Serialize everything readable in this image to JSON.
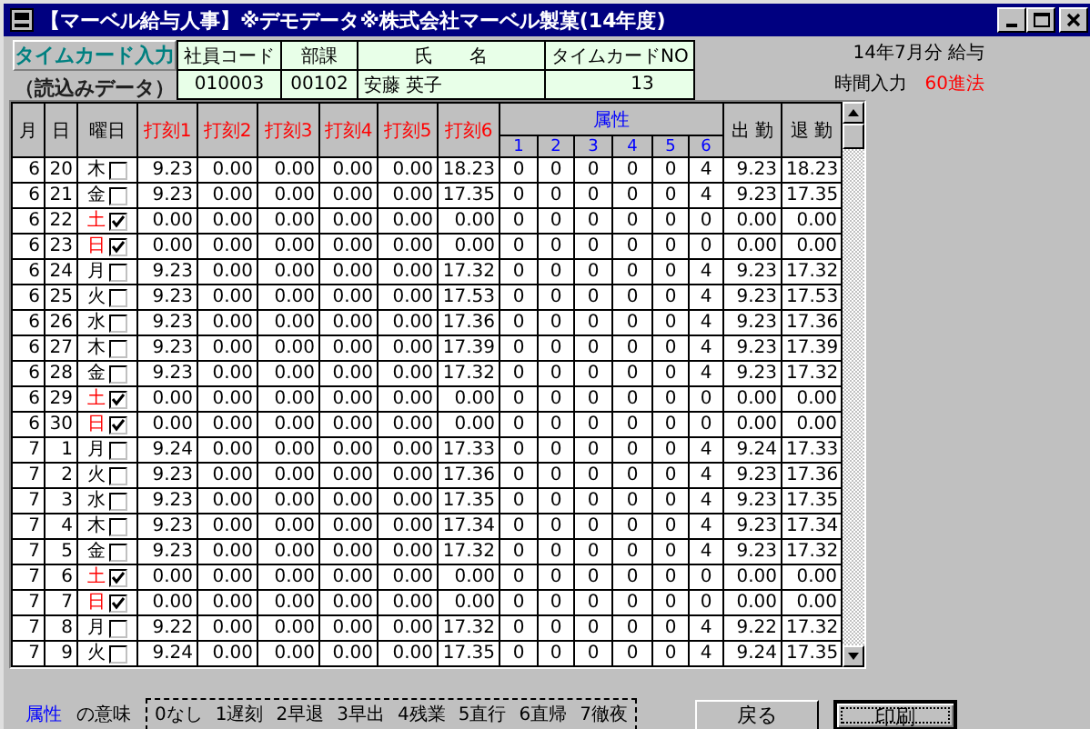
{
  "window": {
    "title": "【マーベル給与人事】※デモデータ※株式会社マーベル製菓(14年度)"
  },
  "header": {
    "mode_label": "タイムカード入力",
    "mode_sub": "（読込みデータ）",
    "employee": [
      {
        "label": "社員コード",
        "value": "010003"
      },
      {
        "label": "部課",
        "value": "00102"
      },
      {
        "label": "氏　　名",
        "value": "安藤 英子"
      },
      {
        "label": "タイムカードNO",
        "value": "13"
      }
    ],
    "period": "14年7月分 給与",
    "input_label": "時間入力",
    "input_mode": "60進法"
  },
  "columns": {
    "month": "月",
    "day": "日",
    "weekday": "曜日",
    "punches": [
      "打刻1",
      "打刻2",
      "打刻3",
      "打刻4",
      "打刻5",
      "打刻6"
    ],
    "attribute_group": "属性",
    "attributes": [
      "1",
      "2",
      "3",
      "4",
      "5",
      "6"
    ],
    "clock_in": "出 勤",
    "clock_out": "退 勤"
  },
  "rows": [
    {
      "month": "6",
      "day": "20",
      "weekday": "木",
      "color": "#000000",
      "checked": false,
      "punches": [
        "9.23",
        "0.00",
        "0.00",
        "0.00",
        "0.00",
        "18.23"
      ],
      "attributes": [
        "0",
        "0",
        "0",
        "0",
        "0",
        "4"
      ],
      "clock_in": "9.23",
      "clock_out": "18.23"
    },
    {
      "month": "6",
      "day": "21",
      "weekday": "金",
      "color": "#000000",
      "checked": false,
      "punches": [
        "9.23",
        "0.00",
        "0.00",
        "0.00",
        "0.00",
        "17.35"
      ],
      "attributes": [
        "0",
        "0",
        "0",
        "0",
        "0",
        "4"
      ],
      "clock_in": "9.23",
      "clock_out": "17.35"
    },
    {
      "month": "6",
      "day": "22",
      "weekday": "土",
      "color": "#ff0000",
      "checked": true,
      "punches": [
        "0.00",
        "0.00",
        "0.00",
        "0.00",
        "0.00",
        "0.00"
      ],
      "attributes": [
        "0",
        "0",
        "0",
        "0",
        "0",
        "0"
      ],
      "clock_in": "0.00",
      "clock_out": "0.00"
    },
    {
      "month": "6",
      "day": "23",
      "weekday": "日",
      "color": "#ff0000",
      "checked": true,
      "punches": [
        "0.00",
        "0.00",
        "0.00",
        "0.00",
        "0.00",
        "0.00"
      ],
      "attributes": [
        "0",
        "0",
        "0",
        "0",
        "0",
        "0"
      ],
      "clock_in": "0.00",
      "clock_out": "0.00"
    },
    {
      "month": "6",
      "day": "24",
      "weekday": "月",
      "color": "#000000",
      "checked": false,
      "punches": [
        "9.23",
        "0.00",
        "0.00",
        "0.00",
        "0.00",
        "17.32"
      ],
      "attributes": [
        "0",
        "0",
        "0",
        "0",
        "0",
        "4"
      ],
      "clock_in": "9.23",
      "clock_out": "17.32"
    },
    {
      "month": "6",
      "day": "25",
      "weekday": "火",
      "color": "#000000",
      "checked": false,
      "punches": [
        "9.23",
        "0.00",
        "0.00",
        "0.00",
        "0.00",
        "17.53"
      ],
      "attributes": [
        "0",
        "0",
        "0",
        "0",
        "0",
        "4"
      ],
      "clock_in": "9.23",
      "clock_out": "17.53"
    },
    {
      "month": "6",
      "day": "26",
      "weekday": "水",
      "color": "#000000",
      "checked": false,
      "punches": [
        "9.23",
        "0.00",
        "0.00",
        "0.00",
        "0.00",
        "17.36"
      ],
      "attributes": [
        "0",
        "0",
        "0",
        "0",
        "0",
        "4"
      ],
      "clock_in": "9.23",
      "clock_out": "17.36"
    },
    {
      "month": "6",
      "day": "27",
      "weekday": "木",
      "color": "#000000",
      "checked": false,
      "punches": [
        "9.23",
        "0.00",
        "0.00",
        "0.00",
        "0.00",
        "17.39"
      ],
      "attributes": [
        "0",
        "0",
        "0",
        "0",
        "0",
        "4"
      ],
      "clock_in": "9.23",
      "clock_out": "17.39"
    },
    {
      "month": "6",
      "day": "28",
      "weekday": "金",
      "color": "#000000",
      "checked": false,
      "punches": [
        "9.23",
        "0.00",
        "0.00",
        "0.00",
        "0.00",
        "17.32"
      ],
      "attributes": [
        "0",
        "0",
        "0",
        "0",
        "0",
        "4"
      ],
      "clock_in": "9.23",
      "clock_out": "17.32"
    },
    {
      "month": "6",
      "day": "29",
      "weekday": "土",
      "color": "#ff0000",
      "checked": true,
      "punches": [
        "0.00",
        "0.00",
        "0.00",
        "0.00",
        "0.00",
        "0.00"
      ],
      "attributes": [
        "0",
        "0",
        "0",
        "0",
        "0",
        "0"
      ],
      "clock_in": "0.00",
      "clock_out": "0.00"
    },
    {
      "month": "6",
      "day": "30",
      "weekday": "日",
      "color": "#ff0000",
      "checked": true,
      "punches": [
        "0.00",
        "0.00",
        "0.00",
        "0.00",
        "0.00",
        "0.00"
      ],
      "attributes": [
        "0",
        "0",
        "0",
        "0",
        "0",
        "0"
      ],
      "clock_in": "0.00",
      "clock_out": "0.00"
    },
    {
      "month": "7",
      "day": "1",
      "weekday": "月",
      "color": "#000000",
      "checked": false,
      "punches": [
        "9.24",
        "0.00",
        "0.00",
        "0.00",
        "0.00",
        "17.33"
      ],
      "attributes": [
        "0",
        "0",
        "0",
        "0",
        "0",
        "4"
      ],
      "clock_in": "9.24",
      "clock_out": "17.33"
    },
    {
      "month": "7",
      "day": "2",
      "weekday": "火",
      "color": "#000000",
      "checked": false,
      "punches": [
        "9.23",
        "0.00",
        "0.00",
        "0.00",
        "0.00",
        "17.36"
      ],
      "attributes": [
        "0",
        "0",
        "0",
        "0",
        "0",
        "4"
      ],
      "clock_in": "9.23",
      "clock_out": "17.36"
    },
    {
      "month": "7",
      "day": "3",
      "weekday": "水",
      "color": "#000000",
      "checked": false,
      "punches": [
        "9.23",
        "0.00",
        "0.00",
        "0.00",
        "0.00",
        "17.35"
      ],
      "attributes": [
        "0",
        "0",
        "0",
        "0",
        "0",
        "4"
      ],
      "clock_in": "9.23",
      "clock_out": "17.35"
    },
    {
      "month": "7",
      "day": "4",
      "weekday": "木",
      "color": "#000000",
      "checked": false,
      "punches": [
        "9.23",
        "0.00",
        "0.00",
        "0.00",
        "0.00",
        "17.34"
      ],
      "attributes": [
        "0",
        "0",
        "0",
        "0",
        "0",
        "4"
      ],
      "clock_in": "9.23",
      "clock_out": "17.34"
    },
    {
      "month": "7",
      "day": "5",
      "weekday": "金",
      "color": "#000000",
      "checked": false,
      "punches": [
        "9.23",
        "0.00",
        "0.00",
        "0.00",
        "0.00",
        "17.32"
      ],
      "attributes": [
        "0",
        "0",
        "0",
        "0",
        "0",
        "4"
      ],
      "clock_in": "9.23",
      "clock_out": "17.32"
    },
    {
      "month": "7",
      "day": "6",
      "weekday": "土",
      "color": "#ff0000",
      "checked": true,
      "punches": [
        "0.00",
        "0.00",
        "0.00",
        "0.00",
        "0.00",
        "0.00"
      ],
      "attributes": [
        "0",
        "0",
        "0",
        "0",
        "0",
        "0"
      ],
      "clock_in": "0.00",
      "clock_out": "0.00"
    },
    {
      "month": "7",
      "day": "7",
      "weekday": "日",
      "color": "#ff0000",
      "checked": true,
      "punches": [
        "0.00",
        "0.00",
        "0.00",
        "0.00",
        "0.00",
        "0.00"
      ],
      "attributes": [
        "0",
        "0",
        "0",
        "0",
        "0",
        "0"
      ],
      "clock_in": "0.00",
      "clock_out": "0.00"
    },
    {
      "month": "7",
      "day": "8",
      "weekday": "月",
      "color": "#000000",
      "checked": false,
      "punches": [
        "9.22",
        "0.00",
        "0.00",
        "0.00",
        "0.00",
        "17.32"
      ],
      "attributes": [
        "0",
        "0",
        "0",
        "0",
        "0",
        "4"
      ],
      "clock_in": "9.22",
      "clock_out": "17.32"
    },
    {
      "month": "7",
      "day": "9",
      "weekday": "火",
      "color": "#000000",
      "checked": false,
      "punches": [
        "9.24",
        "0.00",
        "0.00",
        "0.00",
        "0.00",
        "17.35"
      ],
      "attributes": [
        "0",
        "0",
        "0",
        "0",
        "0",
        "4"
      ],
      "clock_in": "9.24",
      "clock_out": "17.35"
    }
  ],
  "footer": {
    "legend_title": "属性",
    "legend_suffix": "の意味",
    "legend": [
      "0なし",
      "1遅刻",
      "2早退",
      "3早出",
      "4残業",
      "5直行",
      "6直帰",
      "7徹夜"
    ]
  },
  "buttons": [
    {
      "label": "戻る",
      "focused": false
    },
    {
      "label": "印刷",
      "focused": true
    }
  ]
}
